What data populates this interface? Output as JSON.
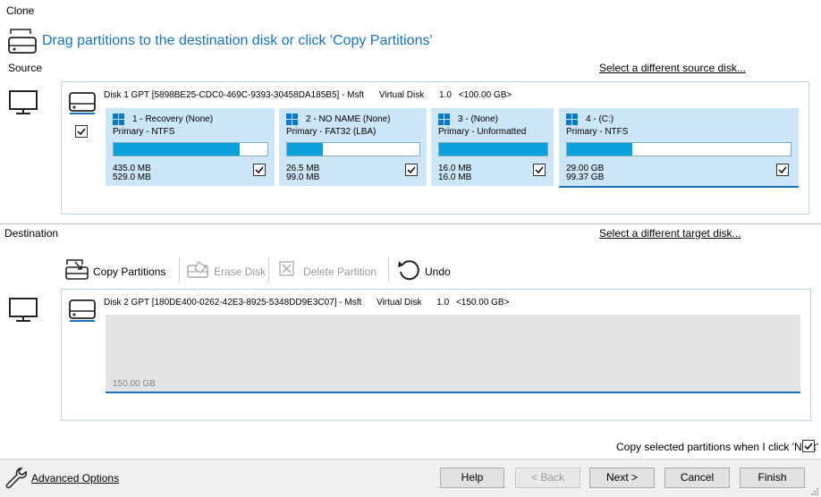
{
  "window": {
    "title": "Clone"
  },
  "header": {
    "instruction": "Drag partitions to the destination disk or click 'Copy Partitions'"
  },
  "source": {
    "label": "Source",
    "select_link": "Select a different source disk...",
    "disk": {
      "name": "Disk 1 GPT [5898BE25-CDC0-469C-9393-30458DA185B5] - Msft",
      "type": "Virtual Disk",
      "version": "1.0",
      "size": "<100.00 GB>"
    },
    "partitions": [
      {
        "title": "1 - Recovery (None)",
        "fs": "Primary - NTFS",
        "used": "435.0 MB",
        "total": "529.0 MB",
        "fill": 0.82
      },
      {
        "title": "2 - NO NAME (None)",
        "fs": "Primary - FAT32 (LBA)",
        "used": "26.5 MB",
        "total": "99.0 MB",
        "fill": 0.27
      },
      {
        "title": "3 - (None)",
        "fs": "Primary - Unformatted",
        "used": "16.0 MB",
        "total": "16.0 MB",
        "fill": 1.0
      },
      {
        "title": "4 - (C:)",
        "fs": "Primary - NTFS",
        "used": "29.00 GB",
        "total": "99.37 GB",
        "fill": 0.29
      }
    ]
  },
  "destination": {
    "label": "Destination",
    "select_link": "Select a different target disk...",
    "toolbar": {
      "copy": "Copy Partitions",
      "erase": "Erase Disk",
      "delete": "Delete Partition",
      "undo": "Undo"
    },
    "disk": {
      "name": "Disk 2 GPT [180DE400-0262-42E3-8925-5348DD9E3C07] - Msft",
      "type": "Virtual Disk",
      "version": "1.0",
      "size": "<150.00 GB>",
      "unallocated": "150.00 GB"
    }
  },
  "copy_option": "Copy selected partitions when I click 'Next'",
  "footer": {
    "advanced": "Advanced Options",
    "help": "Help",
    "back": "< Back",
    "next": "Next >",
    "cancel": "Cancel",
    "finish": "Finish"
  },
  "colors": {
    "accent": "#1a73b8",
    "partition_bg": "#cce5f7",
    "usage_fill": "#0d9fdc"
  }
}
